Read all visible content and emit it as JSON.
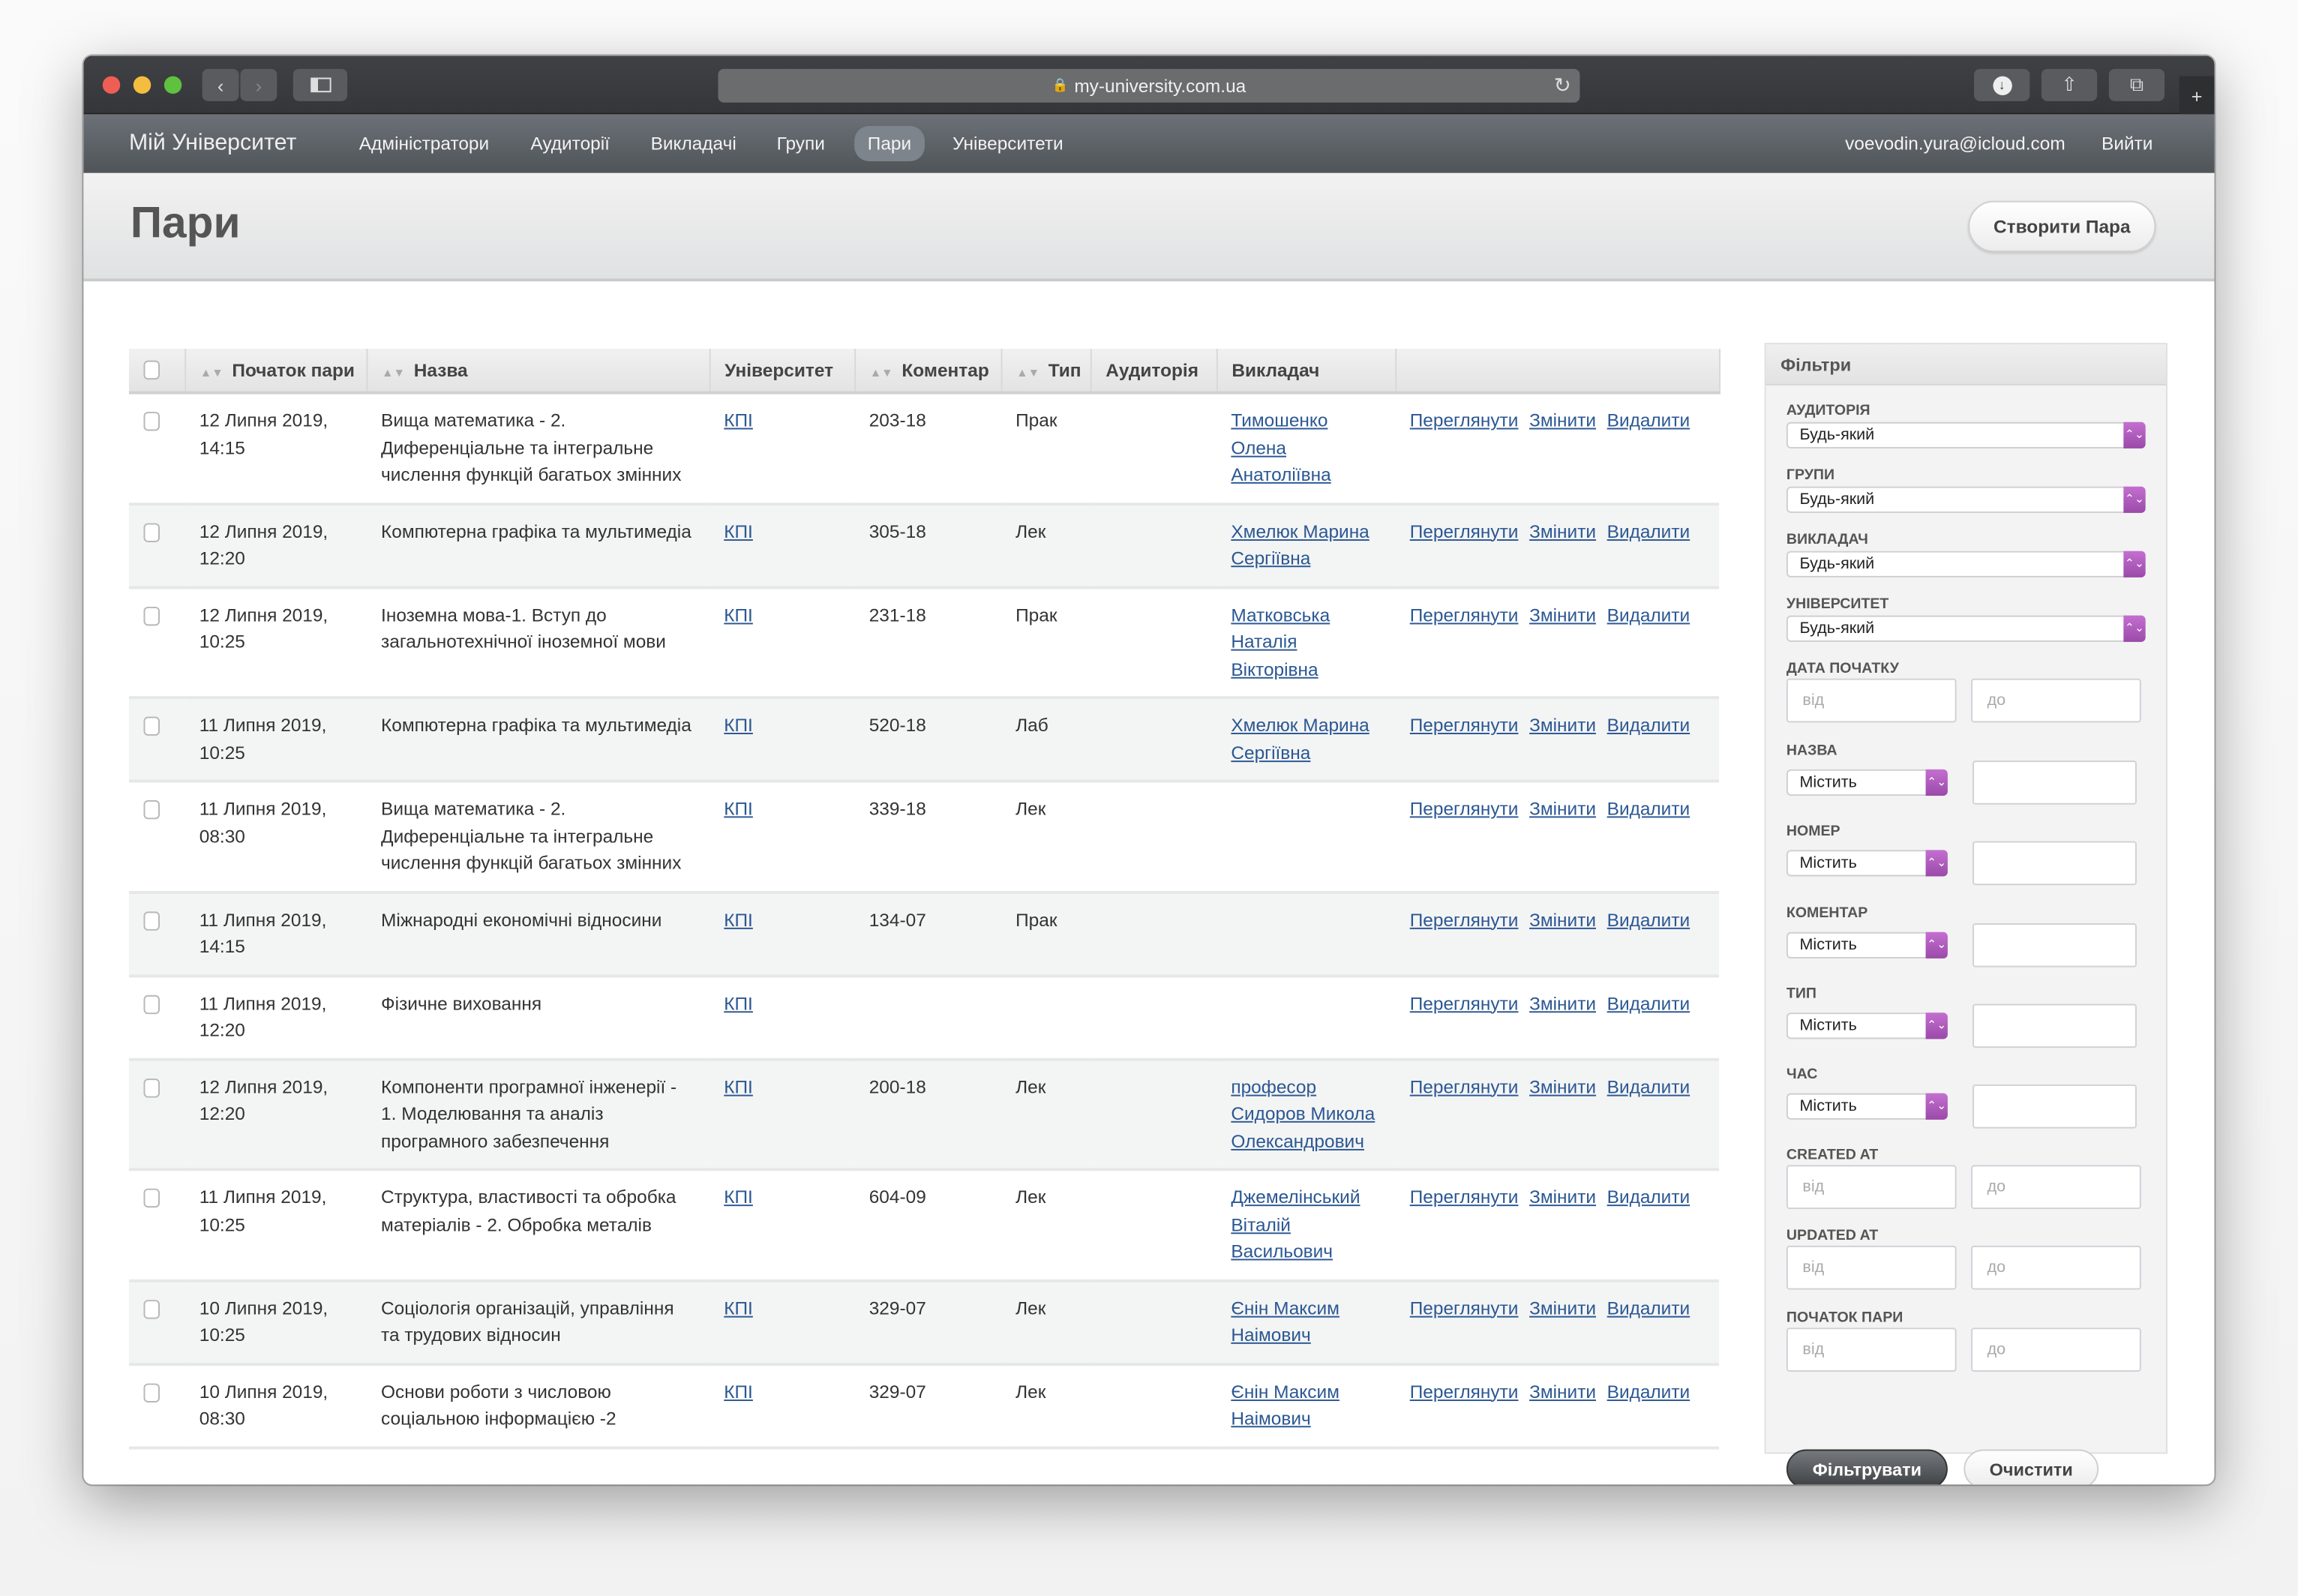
{
  "browser": {
    "url": "my-university.com.ua",
    "colors": {
      "close": "#ee5e55",
      "min": "#f4bd3f",
      "max": "#5fc13d"
    }
  },
  "nav": {
    "brand": "Мій Університет",
    "items": [
      "Адміністратори",
      "Аудиторії",
      "Викладачі",
      "Групи",
      "Пари",
      "Університети"
    ],
    "active": "Пари",
    "user_email": "voevodin.yura@icloud.com",
    "logout": "Вийти"
  },
  "header": {
    "title": "Пари",
    "create_button": "Створити Пара"
  },
  "table": {
    "columns": [
      "",
      "Початок пари",
      "Назва",
      "Університет",
      "Коментар",
      "Тип",
      "Аудиторія",
      "Викладач",
      ""
    ],
    "actions": {
      "view": "Переглянути",
      "edit": "Змінити",
      "delete": "Видалити"
    },
    "rows": [
      {
        "date": "12 Липня 2019, 14:15",
        "name": "Вища математика - 2. Диференціальне та інтегральне числення функцій багатьох змінних",
        "university": "КПІ",
        "comment": "203-18",
        "type": "Прак",
        "room": "",
        "teacher": "Тимошенко Олена Анатоліївна"
      },
      {
        "date": "12 Липня 2019, 12:20",
        "name": "Компютерна графіка та мультимедіа",
        "university": "КПІ",
        "comment": "305-18",
        "type": "Лек",
        "room": "",
        "teacher": "Хмелюк Марина Сергіївна"
      },
      {
        "date": "12 Липня 2019, 10:25",
        "name": "Іноземна мова-1. Вступ до загальнотехнічної іноземної мови",
        "university": "КПІ",
        "comment": "231-18",
        "type": "Прак",
        "room": "",
        "teacher": "Матковська Наталія Вікторівна"
      },
      {
        "date": "11 Липня 2019, 10:25",
        "name": "Компютерна графіка та мультимедіа",
        "university": "КПІ",
        "comment": "520-18",
        "type": "Лаб",
        "room": "",
        "teacher": "Хмелюк Марина Сергіївна"
      },
      {
        "date": "11 Липня 2019, 08:30",
        "name": "Вища математика - 2. Диференціальне та інтегральне числення функцій багатьох змінних",
        "university": "КПІ",
        "comment": "339-18",
        "type": "Лек",
        "room": "",
        "teacher": ""
      },
      {
        "date": "11 Липня 2019, 14:15",
        "name": "Міжнародні економічні відносини",
        "university": "КПІ",
        "comment": "134-07",
        "type": "Прак",
        "room": "",
        "teacher": ""
      },
      {
        "date": "11 Липня 2019, 12:20",
        "name": "Фізичне виховання",
        "university": "КПІ",
        "comment": "",
        "type": "",
        "room": "",
        "teacher": ""
      },
      {
        "date": "12 Липня 2019, 12:20",
        "name": "Компоненти програмної інженерії - 1. Моделювання та аналіз програмного забезпечення",
        "university": "КПІ",
        "comment": "200-18",
        "type": "Лек",
        "room": "",
        "teacher": "професор Сидоров Микола Олександрович"
      },
      {
        "date": "11 Липня 2019, 10:25",
        "name": "Структура, властивості та обробка матеріалів - 2. Обробка металів",
        "university": "КПІ",
        "comment": "604-09",
        "type": "Лек",
        "room": "",
        "teacher": "Джемелінський Віталій Васильович"
      },
      {
        "date": "10 Липня 2019, 10:25",
        "name": "Соціологія організацій, управління та трудових відносин",
        "university": "КПІ",
        "comment": "329-07",
        "type": "Лек",
        "room": "",
        "teacher": "Єнін Максим Наімович"
      },
      {
        "date": "10 Липня 2019, 08:30",
        "name": "Основи роботи з числовою соціальною інформацією -2",
        "university": "КПІ",
        "comment": "329-07",
        "type": "Лек",
        "room": "",
        "teacher": "Єнін Максим Наімович"
      }
    ]
  },
  "filters": {
    "title": "Фільтри",
    "any": "Будь-який",
    "contains": "Містить",
    "from": "від",
    "to": "до",
    "selects": [
      "Аудиторія",
      "Групи",
      "Викладач",
      "Університет"
    ],
    "date_start": "Дата початку",
    "text_filters": [
      "Назва",
      "Номер",
      "Коментар",
      "Тип",
      "Час"
    ],
    "ranges": [
      "Created at",
      "Updated at",
      "Початок пари"
    ],
    "filter_button": "Фільтрувати",
    "clear_button": "Очистити",
    "accent": "#a452b3"
  }
}
